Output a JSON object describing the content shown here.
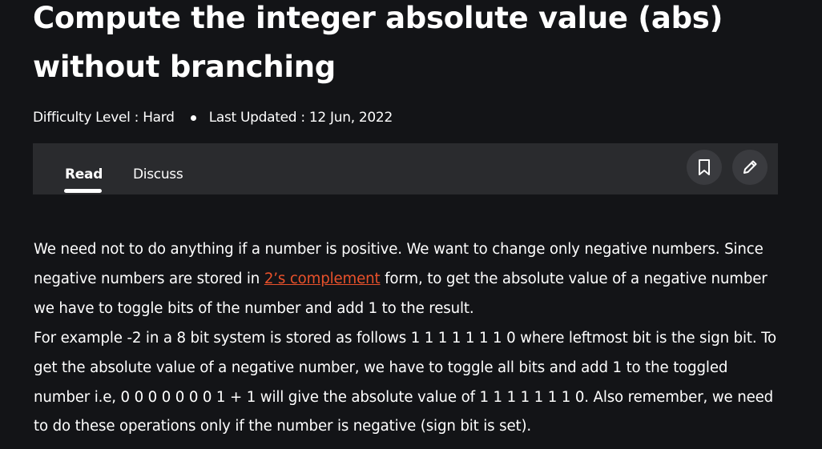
{
  "article": {
    "title": "Compute the integer absolute value (abs) without branching",
    "meta": {
      "difficulty": "Difficulty Level : Hard",
      "updated": "Last Updated : 12 Jun, 2022"
    },
    "tabs": [
      {
        "label": "Read",
        "active": true
      },
      {
        "label": "Discuss",
        "active": false
      }
    ],
    "actions": {
      "bookmark_icon": "bookmark-icon",
      "edit_icon": "pencil-icon"
    },
    "body": {
      "p1_before_link": "We need not to do anything if a number is positive. We want to change only negative numbers. Since negative numbers are stored in ",
      "p1_link": "2’s complement",
      "p1_after_link": " form, to get the absolute value of a negative number we have to toggle bits of the number and add 1 to the result.",
      "p2": "For example -2 in a 8 bit system is stored as follows 1 1 1 1 1 1 1 0 where leftmost bit is the sign bit. To get the absolute value of a negative number, we have to toggle all bits and add 1 to the toggled number i.e, 0 0 0 0 0 0 0 1 + 1 will give the absolute value of 1 1 1 1 1 1 1 0. Also remember, we need to do these operations only if the number is negative (sign bit is set)."
    }
  },
  "colors": {
    "background": "#131417",
    "tabbar": "#2a2b2e",
    "link": "#e8512b",
    "text": "#ffffff"
  }
}
